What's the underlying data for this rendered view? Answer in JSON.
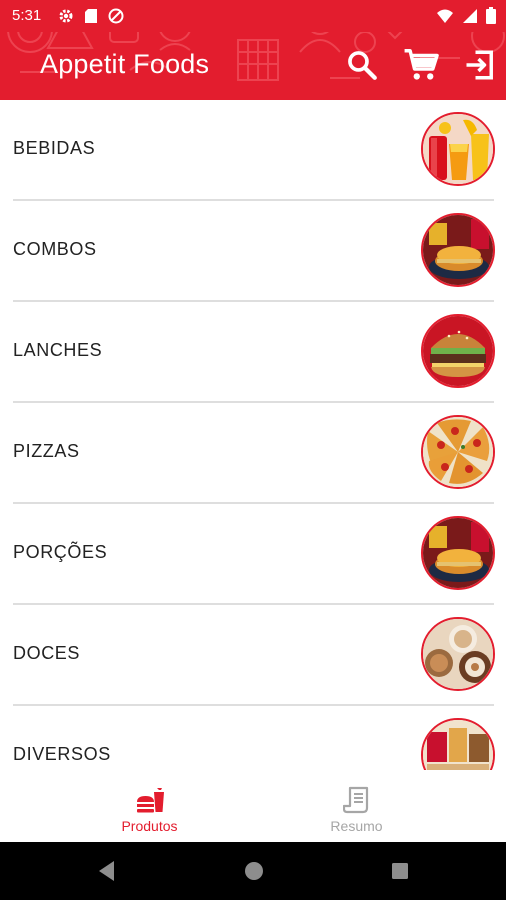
{
  "status_bar": {
    "time": "5:31"
  },
  "app_bar": {
    "title": "Appetit Foods",
    "accent_color": "#e31d2e",
    "actions": [
      "search-icon",
      "cart-icon",
      "exit-icon"
    ]
  },
  "categories": [
    {
      "label": "BEBIDAS",
      "image": "drinks-photo"
    },
    {
      "label": "COMBOS",
      "image": "combo-photo"
    },
    {
      "label": "LANCHES",
      "image": "burger-photo"
    },
    {
      "label": "PIZZAS",
      "image": "pizza-photo"
    },
    {
      "label": "PORÇÕES",
      "image": "combo-photo"
    },
    {
      "label": "DOCES",
      "image": "desserts-photo"
    },
    {
      "label": "DIVERSOS",
      "image": "misc-photo"
    }
  ],
  "bottom_nav": {
    "items": [
      {
        "label": "Produtos",
        "icon": "food-icon",
        "active": true
      },
      {
        "label": "Resumo",
        "icon": "receipt-icon",
        "active": false
      }
    ],
    "active_color": "#e31d2e",
    "inactive_color": "#a6a6a6"
  }
}
